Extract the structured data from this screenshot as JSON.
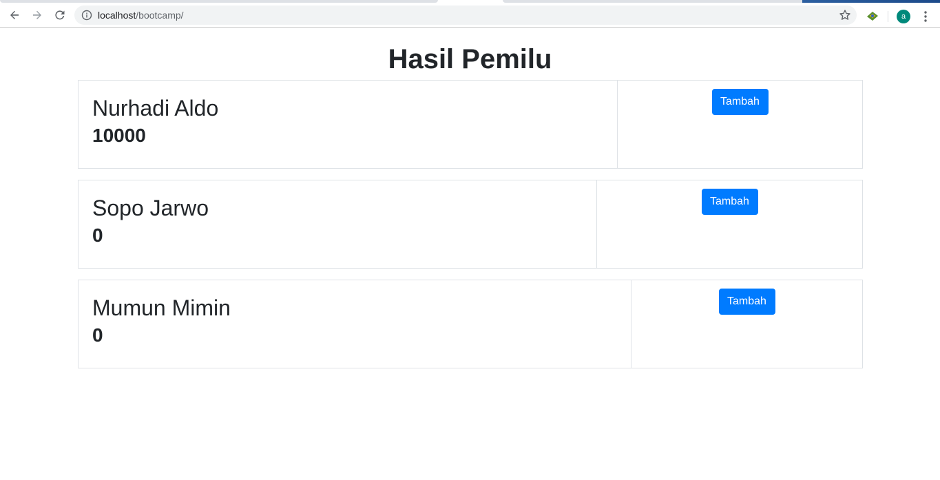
{
  "browser": {
    "url_host": "localhost",
    "url_path": "/bootcamp/",
    "avatar_letter": "a",
    "icons": [
      "back-icon",
      "forward-icon",
      "reload-icon",
      "info-icon",
      "star-icon",
      "extension-icon",
      "menu-icon"
    ]
  },
  "page": {
    "title": "Hasil Pemilu",
    "candidates": [
      {
        "name": "Nurhadi Aldo",
        "votes": "10000",
        "button_label": "Tambah"
      },
      {
        "name": "Sopo Jarwo",
        "votes": "0",
        "button_label": "Tambah"
      },
      {
        "name": "Mumun Mimin",
        "votes": "0",
        "button_label": "Tambah"
      }
    ]
  },
  "colors": {
    "button": "#007bff",
    "border": "#dee2e6",
    "text": "#212529",
    "avatar": "#00897b"
  }
}
